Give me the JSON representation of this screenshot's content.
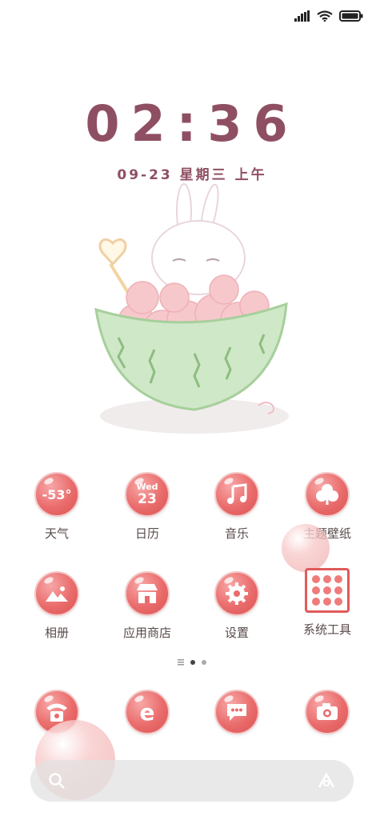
{
  "clock": {
    "time": "02:36"
  },
  "date": {
    "text": "09-23 星期三 上午"
  },
  "apps_row1": [
    {
      "label": "天气",
      "icon": "weather-icon",
      "icon_text": "-53°"
    },
    {
      "label": "日历",
      "icon": "calendar-icon",
      "day": "Wed",
      "date": "23"
    },
    {
      "label": "音乐",
      "icon": "music-note-icon"
    },
    {
      "label": "主题壁纸",
      "icon": "clover-icon"
    }
  ],
  "apps_row2": [
    {
      "label": "相册",
      "icon": "mountain-photo-icon"
    },
    {
      "label": "应用商店",
      "icon": "shop-icon"
    },
    {
      "label": "设置",
      "icon": "gear-icon"
    },
    {
      "label": "系统工具",
      "icon": "folder-grid-icon"
    }
  ],
  "dock": [
    {
      "name": "phone",
      "icon": "telephone-icon"
    },
    {
      "name": "browser",
      "icon": "browser-e-icon"
    },
    {
      "name": "messages",
      "icon": "message-bubble-icon"
    },
    {
      "name": "camera",
      "icon": "camera-icon"
    }
  ],
  "page_indicator": {
    "pages": 3,
    "current": 2
  },
  "colors": {
    "accent": "#e86a6a",
    "clock": "#8f4f62",
    "label": "#5a4a4a"
  }
}
